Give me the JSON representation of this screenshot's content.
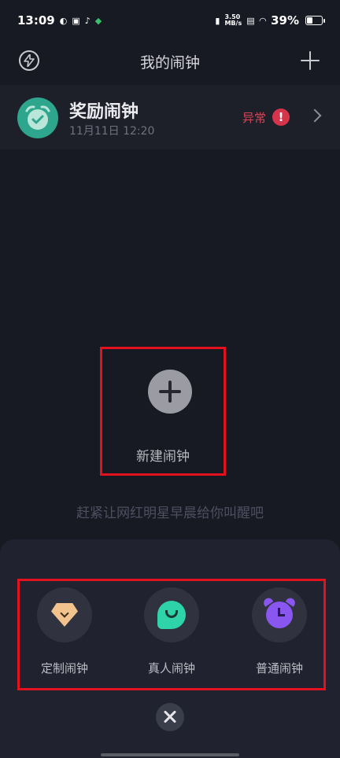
{
  "status_bar": {
    "time": "13:09",
    "net_speed_value": "3.50",
    "net_speed_unit": "MB/s",
    "battery_percent_label": "39%",
    "battery_level": 0.39,
    "icons": [
      "weibo-icon",
      "notification-icon",
      "tiktok-icon",
      "shield-icon",
      "vibrate-icon",
      "network-icon",
      "wifi-icon",
      "battery-icon"
    ]
  },
  "header": {
    "title": "我的闹钟",
    "left_icon": "lightning-icon",
    "right_icon": "add-icon"
  },
  "alarm": {
    "name": "奖励闹钟",
    "time": "11月11日 12:20",
    "status": "异常",
    "status_color": "#d64656",
    "icon": "alarm-clock-check-icon"
  },
  "new_alarm": {
    "label": "新建闹钟",
    "icon": "plus-icon"
  },
  "hint": "赶紧让网红明星早晨给你叫醒吧",
  "alarm_types": [
    {
      "label": "定制闹钟",
      "icon": "custom-gem-icon"
    },
    {
      "label": "真人闹钟",
      "icon": "real-person-chat-icon"
    },
    {
      "label": "普通闹钟",
      "icon": "normal-alarm-icon"
    }
  ],
  "close_icon": "close-icon"
}
